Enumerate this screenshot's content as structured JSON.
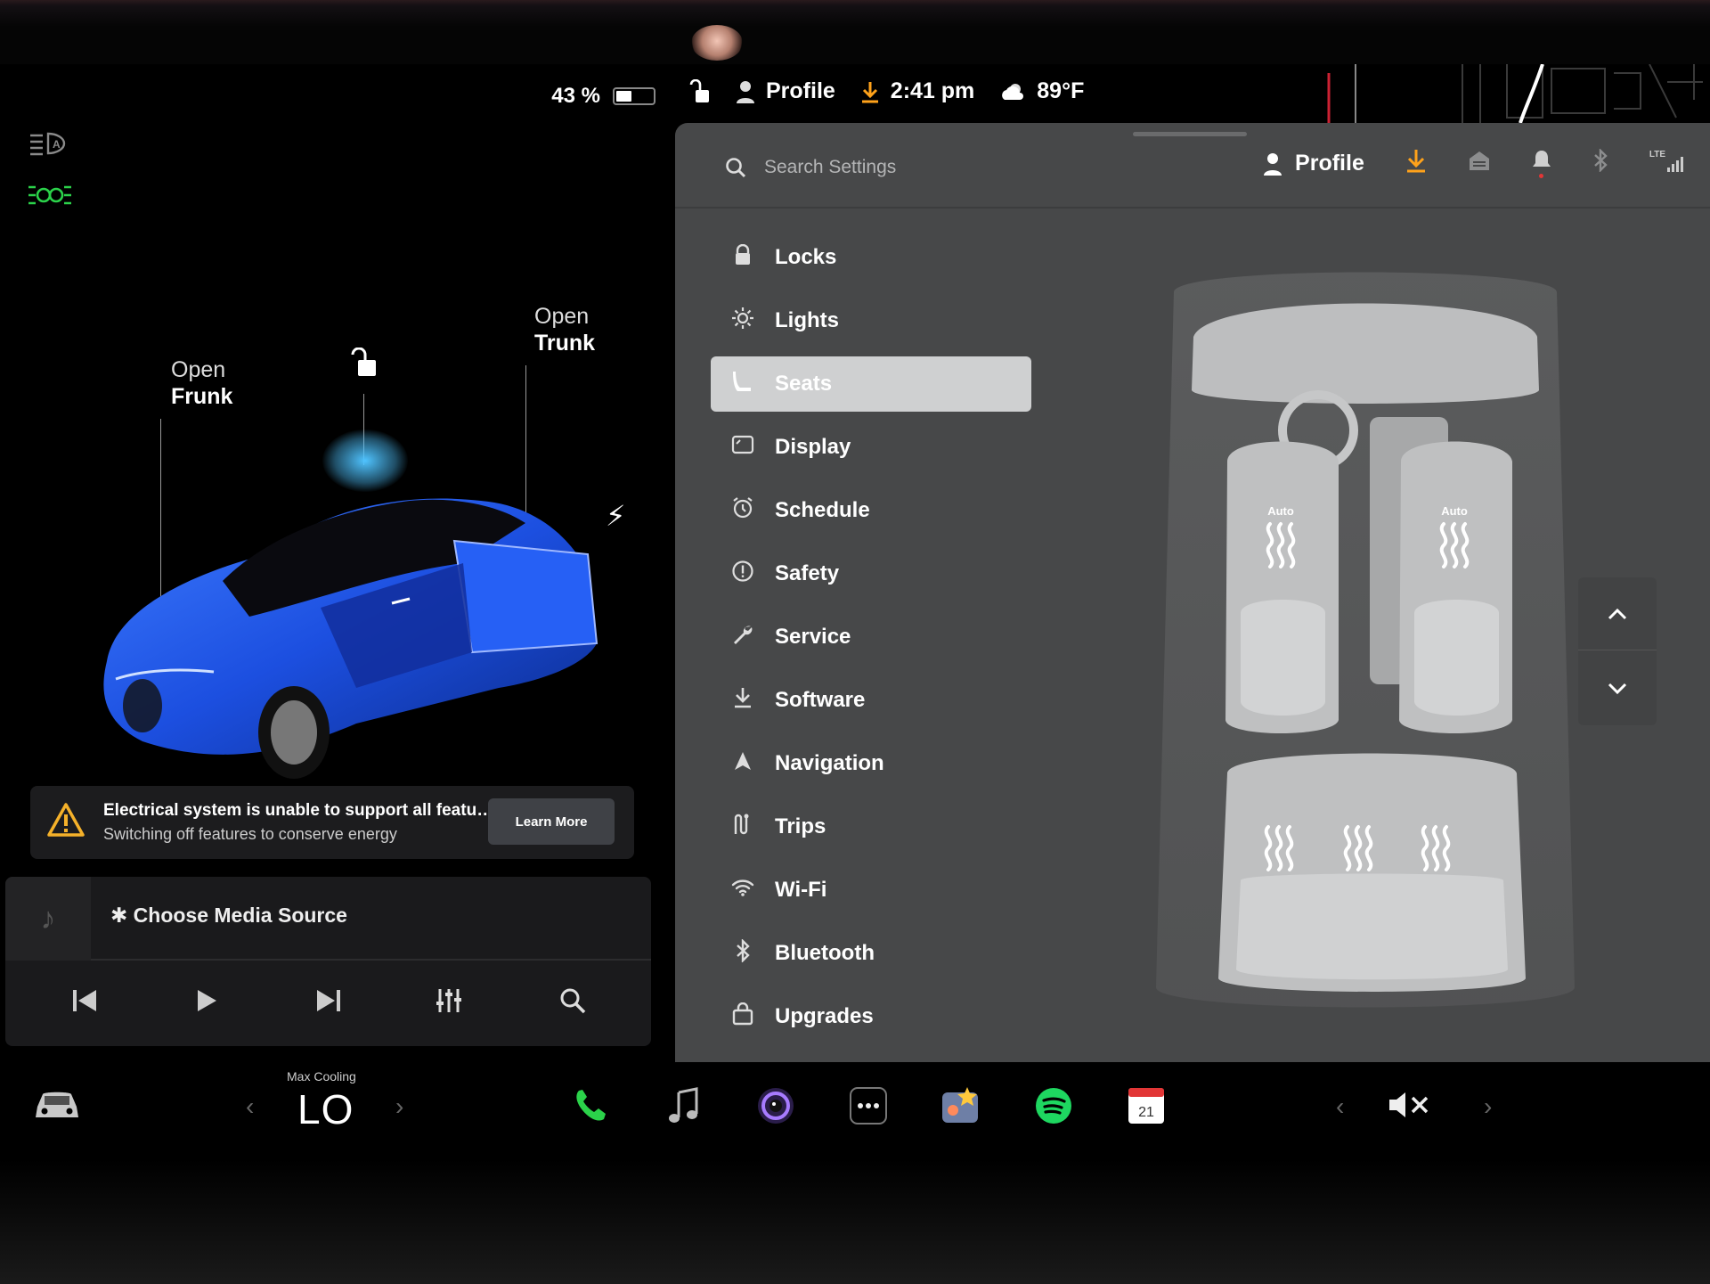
{
  "status": {
    "battery_percent": "43 %",
    "battery_level": 0.43,
    "profile": "Profile",
    "time": "2:41 pm",
    "temperature": "89°F"
  },
  "car": {
    "frunk_open": "Open",
    "frunk_label": "Frunk",
    "trunk_open": "Open",
    "trunk_label": "Trunk",
    "color": "#1c4fe0"
  },
  "alert": {
    "title": "Electrical system is unable to support all featur...",
    "subtitle": "Switching off features to conserve energy",
    "button": "Learn More"
  },
  "media": {
    "source_label": "Choose Media Source"
  },
  "settings": {
    "search_placeholder": "Search Settings",
    "profile": "Profile",
    "lte": "LTE",
    "menu": [
      {
        "label": "Locks",
        "icon": "lock-icon"
      },
      {
        "label": "Lights",
        "icon": "sun-icon"
      },
      {
        "label": "Seats",
        "icon": "seat-icon"
      },
      {
        "label": "Display",
        "icon": "display-icon"
      },
      {
        "label": "Schedule",
        "icon": "alarm-icon"
      },
      {
        "label": "Safety",
        "icon": "alert-circle-icon"
      },
      {
        "label": "Service",
        "icon": "wrench-icon"
      },
      {
        "label": "Software",
        "icon": "download-icon"
      },
      {
        "label": "Navigation",
        "icon": "navigation-icon"
      },
      {
        "label": "Trips",
        "icon": "trips-icon"
      },
      {
        "label": "Wi-Fi",
        "icon": "wifi-icon"
      },
      {
        "label": "Bluetooth",
        "icon": "bluetooth-icon"
      },
      {
        "label": "Upgrades",
        "icon": "bag-icon"
      }
    ],
    "active": "Seats",
    "seats": {
      "front_left_mode": "Auto",
      "front_right_mode": "Auto"
    }
  },
  "dock": {
    "climate_label": "Max Cooling",
    "climate_value": "LO",
    "calendar_day": "21"
  },
  "colors": {
    "accent_download": "#ffa21a",
    "drl_green": "#2bd24a",
    "settings_bg": "#474849",
    "active_item": "#cfd0d1"
  }
}
